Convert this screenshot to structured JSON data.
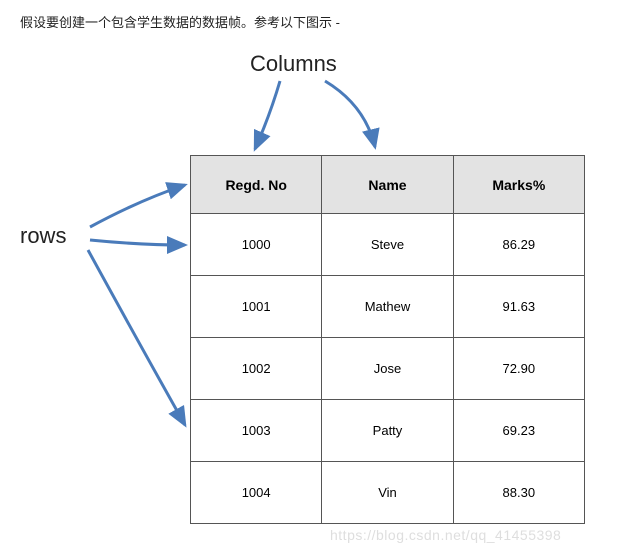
{
  "intro_text": "假设要创建一个包含学生数据的数据帧。参考以下图示 -",
  "labels": {
    "columns": "Columns",
    "rows": "rows"
  },
  "chart_data": {
    "type": "table",
    "title": "",
    "columns": [
      "Regd. No",
      "Name",
      "Marks%"
    ],
    "rows": [
      {
        "regd_no": "1000",
        "name": "Steve",
        "marks": "86.29"
      },
      {
        "regd_no": "1001",
        "name": "Mathew",
        "marks": "91.63"
      },
      {
        "regd_no": "1002",
        "name": "Jose",
        "marks": "72.90"
      },
      {
        "regd_no": "1003",
        "name": "Patty",
        "marks": "69.23"
      },
      {
        "regd_no": "1004",
        "name": "Vin",
        "marks": "88.30"
      }
    ],
    "annotations": {
      "columns_arrow_targets": [
        "header"
      ],
      "rows_arrow_targets": [
        "row1",
        "row2",
        "row4"
      ]
    }
  },
  "watermark": "https://blog.csdn.net/qq_41455398"
}
